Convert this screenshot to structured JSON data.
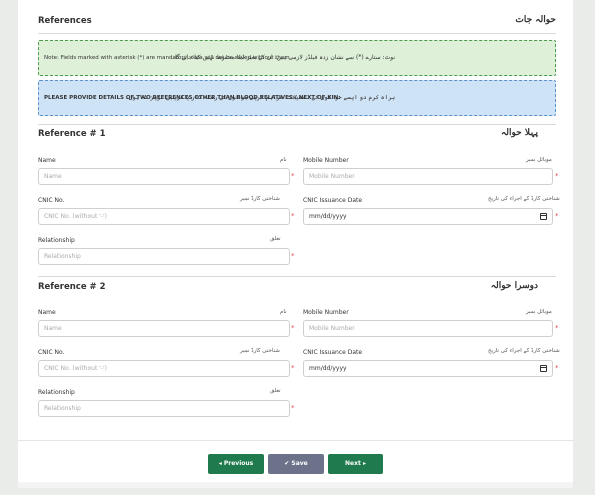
{
  "section": {
    "title_en": "References",
    "title_ur": "حوالہ جات"
  },
  "notes": {
    "mandatory_en": "Note: Fields marked with asterisk (*) are mandatory, data will not be saved without them.",
    "mandatory_ur": "نوٹ: ستارے (*) سے نشان زدہ فیلڈز لازمی ہیں، ان کے بغیر ڈیٹا محفوظ نہیں کیا جائے گا۔",
    "references_en": "PLEASE PROVIDE DETAILS OF TWO REFERENCES OTHER THAN BLOOD RELATIVES / NEXT OF KIN:",
    "references_ur": "براہ کرم دو ایسے حوالوں کی تفصیلات فراہم کریں جو خون کے رشتہ دار یا قریبی عزیز نہ ہوں۔"
  },
  "references": [
    {
      "title_en": "Reference # 1",
      "title_ur": "پہلا حوالہ",
      "name_label": "Name",
      "name_label_ur": "نام",
      "name_placeholder": "Name",
      "mobile_label": "Mobile Number",
      "mobile_label_ur": "موبائل نمبر",
      "mobile_placeholder": "Mobile Number",
      "cnic_label": "CNIC No.",
      "cnic_label_ur": "شناختی کارڈ نمبر",
      "cnic_placeholder": "CNIC No. (without '-')",
      "issue_label": "CNIC Issuance Date",
      "issue_label_ur": "شناختی کارڈ کے اجراء کی تاریخ",
      "issue_value": "mm/dd/yyyy",
      "rel_label": "Relationship",
      "rel_label_ur": "تعلق",
      "rel_placeholder": "Relationship"
    },
    {
      "title_en": "Reference # 2",
      "title_ur": "دوسرا حوالہ",
      "name_label": "Name",
      "name_label_ur": "نام",
      "name_placeholder": "Name",
      "mobile_label": "Mobile Number",
      "mobile_label_ur": "موبائل نمبر",
      "mobile_placeholder": "Mobile Number",
      "cnic_label": "CNIC No.",
      "cnic_label_ur": "شناختی کارڈ نمبر",
      "cnic_placeholder": "CNIC No. (without '-')",
      "issue_label": "CNIC Issuance Date",
      "issue_label_ur": "شناختی کارڈ کے اجراء کی تاریخ",
      "issue_value": "mm/dd/yyyy",
      "rel_label": "Relationship",
      "rel_label_ur": "تعلق",
      "rel_placeholder": "Relationship"
    }
  ],
  "required_mark": "*",
  "buttons": {
    "previous": "◂ Previous",
    "save": "✔ Save",
    "next": "Next ▸"
  },
  "colors": {
    "primary_green": "#1f7a4d",
    "save_gray": "#6c7289",
    "note_green_bg": "#def0d8",
    "note_blue_bg": "#cfe3f7",
    "required_red": "#e05050"
  },
  "icons": {
    "calendar": "calendar-icon"
  }
}
